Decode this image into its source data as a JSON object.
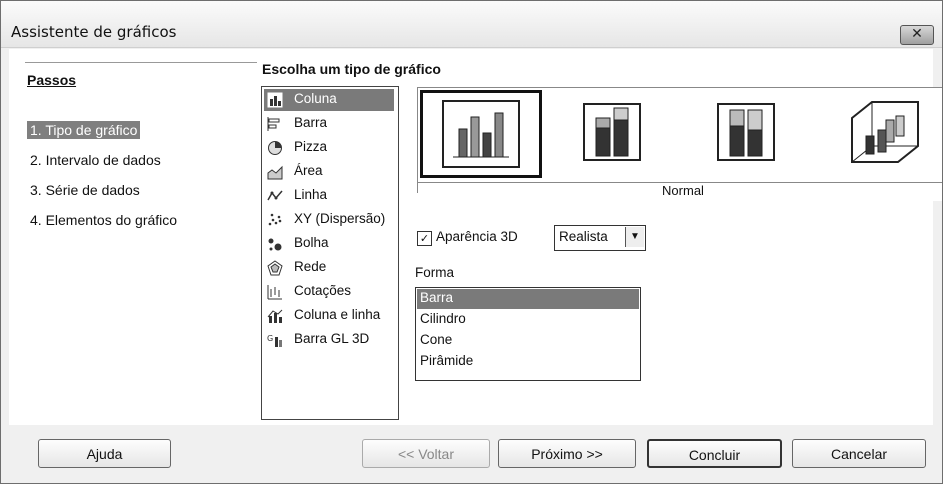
{
  "window": {
    "title": "Assistente de gráficos",
    "close_glyph": "✕"
  },
  "steps": {
    "title": "Passos",
    "items": [
      {
        "label": "1. Tipo de gráfico",
        "active": true
      },
      {
        "label": "2. Intervalo de dados",
        "active": false
      },
      {
        "label": "3. Série de dados",
        "active": false
      },
      {
        "label": "4. Elementos do gráfico",
        "active": false
      }
    ]
  },
  "chart_type": {
    "title": "Escolha um tipo de gráfico",
    "types": [
      {
        "label": "Coluna",
        "icon": "column-chart-icon"
      },
      {
        "label": "Barra",
        "icon": "bar-chart-icon"
      },
      {
        "label": "Pizza",
        "icon": "pie-chart-icon"
      },
      {
        "label": "Área",
        "icon": "area-chart-icon"
      },
      {
        "label": "Linha",
        "icon": "line-chart-icon"
      },
      {
        "label": "XY (Dispersão)",
        "icon": "scatter-chart-icon"
      },
      {
        "label": "Bolha",
        "icon": "bubble-chart-icon"
      },
      {
        "label": "Rede",
        "icon": "net-chart-icon"
      },
      {
        "label": "Cotações",
        "icon": "stock-chart-icon"
      },
      {
        "label": "Coluna e linha",
        "icon": "column-line-chart-icon"
      },
      {
        "label": "Barra GL 3D",
        "icon": "gl3d-bar-chart-icon"
      }
    ],
    "selected_type": "Coluna",
    "variant_caption": "Normal",
    "appearance_3d": {
      "label": "Aparência 3D",
      "underline_char": "3",
      "checked": true
    },
    "appearance_combo": {
      "value": "Realista",
      "arrow": "▼"
    },
    "shape_label": "Forma",
    "shapes": [
      {
        "label": "Barra",
        "active": true
      },
      {
        "label": "Cilindro",
        "active": false
      },
      {
        "label": "Cone",
        "active": false
      },
      {
        "label": "Pirâmide",
        "active": false
      }
    ]
  },
  "buttons": {
    "help": "Ajuda",
    "back": "<< Voltar",
    "next": "Próximo >>",
    "finish": "Concluir",
    "cancel": "Cancelar"
  }
}
